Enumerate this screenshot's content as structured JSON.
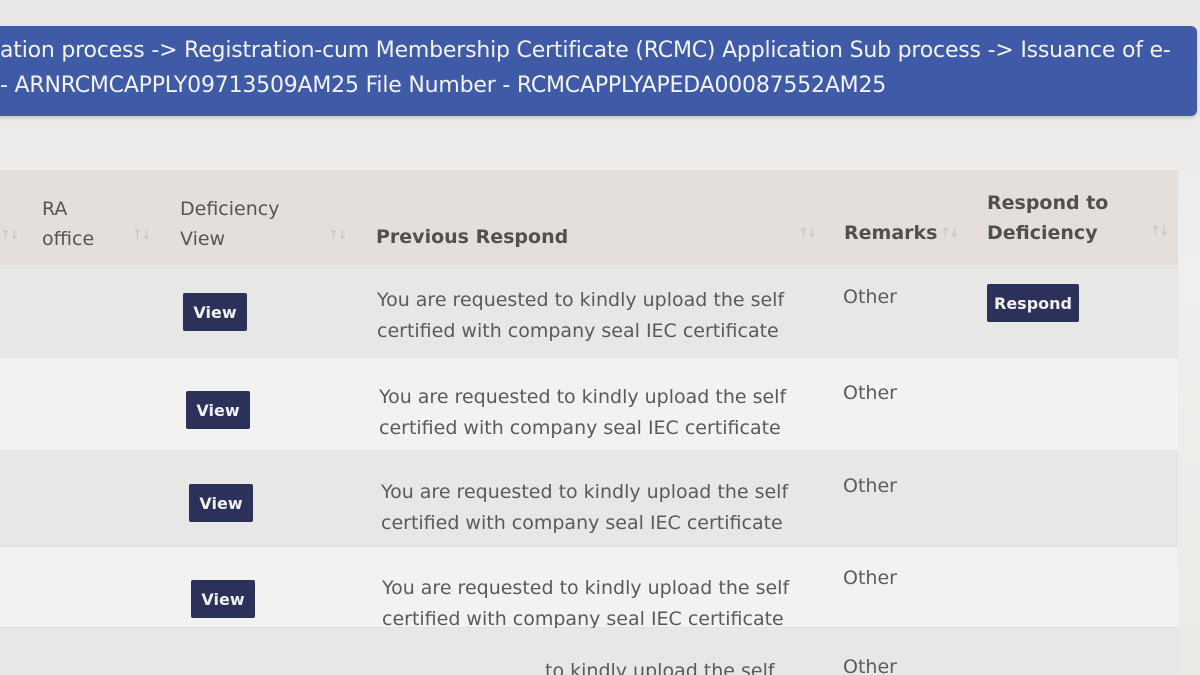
{
  "banner": {
    "line1": "ation process -> Registration-cum Membership Certificate (RCMC) Application Sub process -> Issuance of e-",
    "line2": "- ARNRCMCAPPLY09713509AM25 File Number - RCMCAPPLYAPEDA00087552AM25"
  },
  "table": {
    "headers": {
      "ra_office_1": "RA",
      "ra_office_2": "office",
      "deficiency_view_1": "Deficiency",
      "deficiency_view_2": "View",
      "previous_respond": "Previous Respond",
      "remarks": "Remarks",
      "respond_to_1": "Respond to",
      "respond_to_2": "Deficiency"
    },
    "sort_icon": "sort-arrows-icon",
    "rows": [
      {
        "view_label": "View",
        "message": "You are requested to kindly upload the self certified with company seal IEC certificate",
        "remarks": "Other",
        "respond_label": "Respond"
      },
      {
        "view_label": "View",
        "message": "You are requested to kindly upload the self certified with company seal IEC certificate",
        "remarks": "Other"
      },
      {
        "view_label": "View",
        "message": "You are requested to kindly upload the self certified with company seal IEC certificate",
        "remarks": "Other"
      },
      {
        "view_label": "View",
        "message": "You are requested to kindly upload the self certified with company seal IEC certificate",
        "remarks": "Other"
      },
      {
        "message": "to kindly upload the self",
        "remarks": "Other"
      }
    ]
  },
  "colors": {
    "banner": "#3f5aa7",
    "button": "#2b3158",
    "header_bg": "#e4dfdb"
  }
}
